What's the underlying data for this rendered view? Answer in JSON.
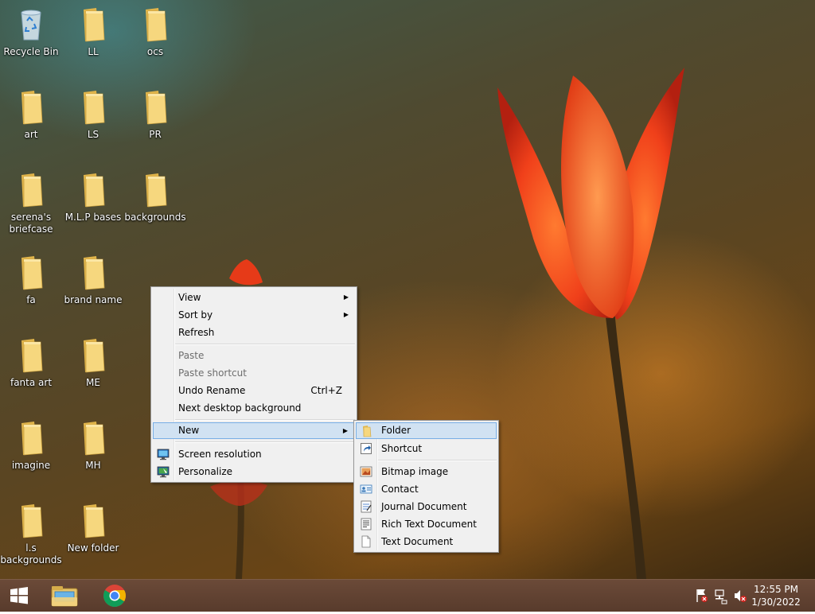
{
  "desktop": {
    "icons": [
      {
        "label": "Recycle Bin",
        "type": "recycle"
      },
      {
        "label": "LL",
        "type": "folder"
      },
      {
        "label": "ocs",
        "type": "folder"
      },
      {
        "label": "art",
        "type": "folder"
      },
      {
        "label": "LS",
        "type": "folder"
      },
      {
        "label": "PR",
        "type": "folder"
      },
      {
        "label": "serena's briefcase",
        "type": "folder"
      },
      {
        "label": "M.L.P bases",
        "type": "folder"
      },
      {
        "label": "backgrounds",
        "type": "folder"
      },
      {
        "label": "fa",
        "type": "folder"
      },
      {
        "label": "brand name",
        "type": "folder"
      },
      {
        "label": "fanta art",
        "type": "folder"
      },
      {
        "label": "ME",
        "type": "folder"
      },
      {
        "label": "imagine",
        "type": "folder"
      },
      {
        "label": "MH",
        "type": "folder"
      },
      {
        "label": "l.s backgrounds",
        "type": "folder"
      },
      {
        "label": "New folder",
        "type": "folder"
      }
    ]
  },
  "context_menu": {
    "view": "View",
    "sort_by": "Sort by",
    "refresh": "Refresh",
    "paste": "Paste",
    "paste_shortcut": "Paste shortcut",
    "undo_rename": "Undo Rename",
    "undo_rename_shortcut": "Ctrl+Z",
    "next_background": "Next desktop background",
    "new": "New",
    "screen_resolution": "Screen resolution",
    "personalize": "Personalize"
  },
  "submenu_new": {
    "folder": "Folder",
    "shortcut": "Shortcut",
    "bitmap": "Bitmap image",
    "contact": "Contact",
    "journal": "Journal Document",
    "rich_text": "Rich Text Document",
    "text": "Text Document"
  },
  "taskbar": {
    "time": "12:55 PM",
    "date": "1/30/2022",
    "pinned": [
      "start-icon",
      "file-explorer-icon",
      "chrome-icon"
    ],
    "tray": [
      "action-center-flag-icon",
      "network-icon",
      "volume-muted-icon"
    ]
  },
  "colors": {
    "menu_bg": "#f0f0f0",
    "menu_highlight": "#d1e2f2",
    "menu_highlight_border": "#78aee5",
    "taskbar": "#5f4131",
    "folder": "#f3d27a"
  }
}
